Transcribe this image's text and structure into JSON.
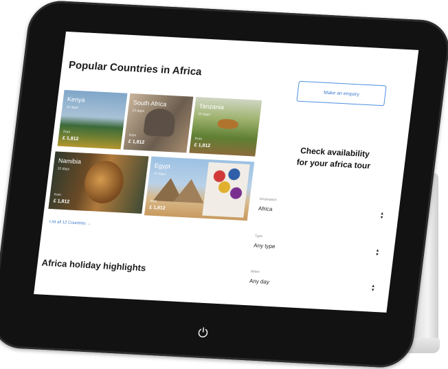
{
  "popular": {
    "title": "Popular Countries in Africa",
    "list_all": "List all 12 Countries →"
  },
  "countries": [
    {
      "name": "Kenya",
      "days": "10 days",
      "from": "from",
      "price": "£ 1,812"
    },
    {
      "name": "South Africa",
      "days": "10 days",
      "from": "from",
      "price": "£ 1,812"
    },
    {
      "name": "Tanzania",
      "days": "10 days",
      "from": "from",
      "price": "£ 1,812"
    },
    {
      "name": "Namibia",
      "days": "10 days",
      "from": "from",
      "price": "£ 1,812"
    },
    {
      "name": "Egypt",
      "days": "10 days",
      "from": "from",
      "price": "£ 1,812"
    }
  ],
  "highlights": {
    "title": "Africa holiday highlights"
  },
  "enquiry": {
    "label": "Make an enquiry"
  },
  "availability": {
    "heading_line1": "Check availability",
    "heading_line2": "for your africa tour",
    "fields": [
      {
        "label": "Destination",
        "value": "Africa"
      },
      {
        "label": "Type",
        "value": "Any type"
      },
      {
        "label": "When",
        "value": "Any day"
      }
    ]
  },
  "icons": {
    "home": "power-icon",
    "select": "up-down-chevron-icon"
  },
  "colors": {
    "accent": "#3a78c9",
    "bezel": "#121212"
  }
}
